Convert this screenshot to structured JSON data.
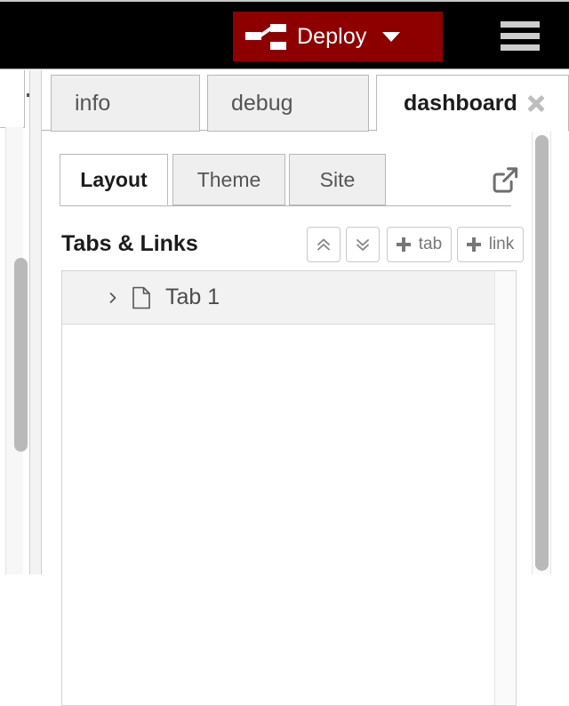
{
  "header": {
    "deploy": {
      "label": "Deploy",
      "icon": "deploy-icon",
      "caret_icon": "chevron-down-icon",
      "color": "#8e0000"
    },
    "menu": {
      "icon": "hamburger-menu-icon"
    },
    "background": "#000000"
  },
  "workspace": {
    "add_flow": {
      "icon": "plus-icon",
      "label": "+"
    },
    "scrollbar": {
      "icon": "vertical-scrollbar"
    }
  },
  "sidebar": {
    "tabs": [
      {
        "label": "info",
        "active": false
      },
      {
        "label": "debug",
        "active": false
      },
      {
        "label": "dashboard",
        "active": true
      }
    ],
    "close": {
      "icon": "close-icon"
    },
    "scrollbar": {
      "icon": "vertical-scrollbar"
    }
  },
  "dashboard": {
    "panel_tabs": [
      {
        "label": "Layout",
        "active": true
      },
      {
        "label": "Theme",
        "active": false
      },
      {
        "label": "Site",
        "active": false
      }
    ],
    "open_dashboard": {
      "icon": "external-link-icon"
    },
    "section": {
      "title": "Tabs & Links",
      "buttons": [
        {
          "name": "collapse-all",
          "label": "",
          "icon": "double-chevron-up-icon"
        },
        {
          "name": "expand-all",
          "label": "",
          "icon": "double-chevron-down-icon"
        },
        {
          "name": "add-tab",
          "label": "tab",
          "icon": "plus-icon"
        },
        {
          "name": "add-link",
          "label": "link",
          "icon": "plus-icon"
        }
      ]
    },
    "tree": [
      {
        "label": "Tab 1",
        "icon": "file-icon",
        "expander": "chevron-right-icon",
        "expanded": false
      }
    ]
  }
}
